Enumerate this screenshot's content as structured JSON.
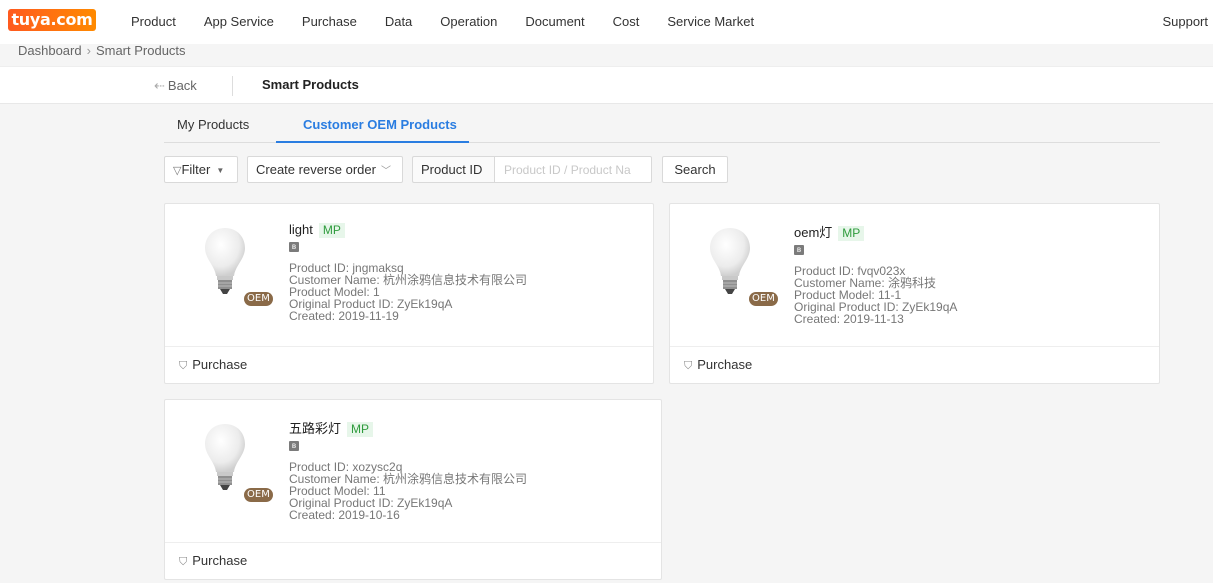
{
  "app": {
    "logo": "tuya.com",
    "support": "Support"
  },
  "nav": [
    "Product",
    "App Service",
    "Purchase",
    "Data",
    "Operation",
    "Document",
    "Cost",
    "Service Market"
  ],
  "breadcrumb": {
    "root": "Dashboard",
    "sep": "›",
    "current": "Smart Products"
  },
  "header": {
    "back": "Back",
    "title": "Smart Products"
  },
  "tabs": {
    "my_products": "My Products",
    "oem_products": "Customer OEM Products"
  },
  "toolbar": {
    "filter": "Filter",
    "reverse_order": "Create reverse order",
    "product_id_label": "Product ID",
    "search_placeholder": "Product ID / Product Na",
    "search_value": "",
    "search": "Search"
  },
  "badges": {
    "mp": "MP",
    "oem": "OEM"
  },
  "labels": {
    "product_id": "Product ID: ",
    "customer_name": "Customer Name: ",
    "model": "Product Model: ",
    "original_id": "Original Product ID: ",
    "created": "Created: ",
    "purchase": "Purchase"
  },
  "products": [
    {
      "name": "light",
      "product_id": "jngmaksq",
      "customer_name": "杭州涂鸦信息技术有限公司",
      "model": "1",
      "original_id": "ZyEk19qA",
      "created": "2019-11-19"
    },
    {
      "name": "oem灯",
      "product_id": "fvqv023x",
      "customer_name": "涂鸦科技",
      "model": "11-1",
      "original_id": "ZyEk19qA",
      "created": "2019-11-13"
    },
    {
      "name": "五路彩灯",
      "product_id": "xozysc2q",
      "customer_name": "杭州涂鸦信息技术有限公司",
      "model": "11",
      "original_id": "ZyEk19qA",
      "created": "2019-10-16"
    }
  ]
}
